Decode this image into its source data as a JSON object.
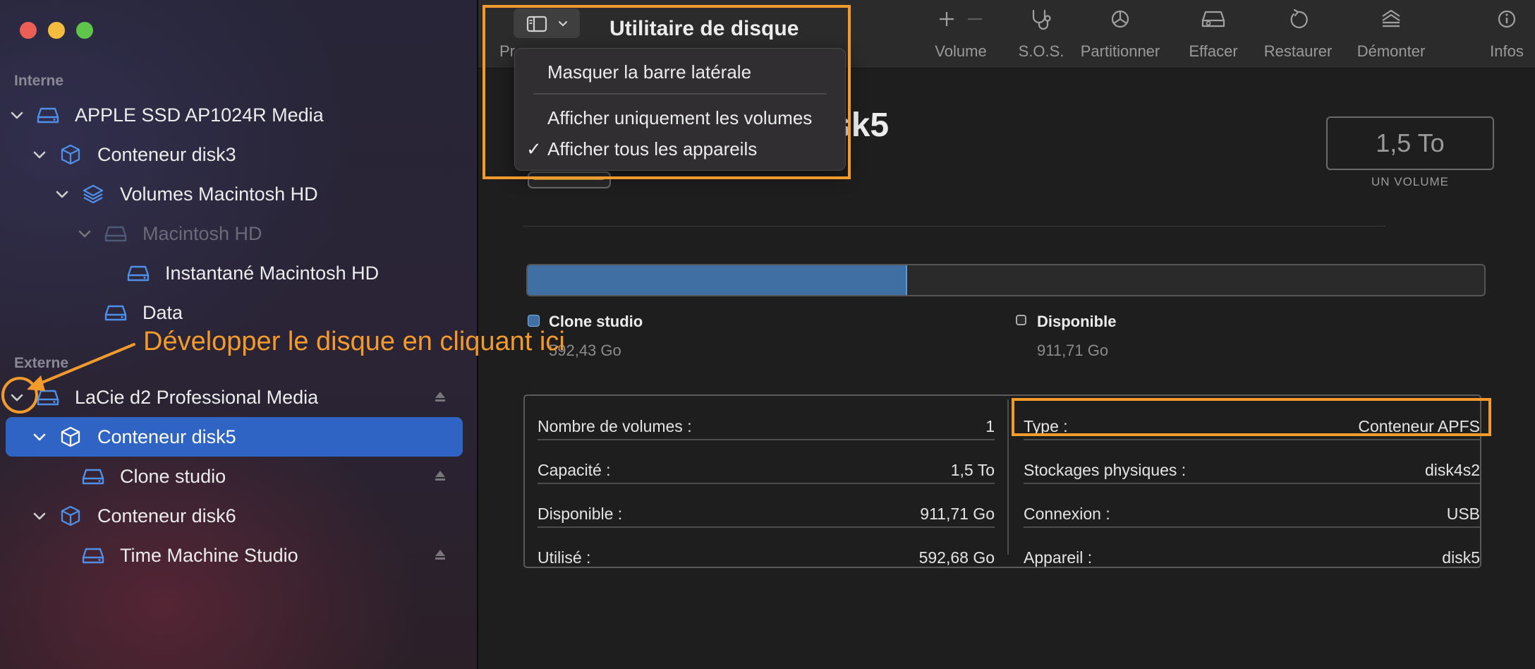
{
  "window": {
    "title": "Utilitaire de disque",
    "traffic_lights": {
      "close": "#ec5f57",
      "minimize": "#f4bd3d",
      "zoom": "#5ec44a"
    }
  },
  "sidebar": {
    "sections": [
      {
        "label": "Interne"
      },
      {
        "label": "Externe"
      }
    ],
    "items": [
      {
        "label": "APPLE SSD AP1024R Media",
        "icon": "drive-icon"
      },
      {
        "label": "Conteneur disk3",
        "icon": "container-icon"
      },
      {
        "label": "Volumes Macintosh HD",
        "icon": "layers-icon"
      },
      {
        "label": "Macintosh HD",
        "icon": "drive-icon"
      },
      {
        "label": "Instantané Macintosh HD",
        "icon": "drive-icon"
      },
      {
        "label": "Data",
        "icon": "drive-icon"
      },
      {
        "label": "LaCie d2 Professional Media",
        "icon": "drive-icon"
      },
      {
        "label": "Conteneur disk5",
        "icon": "container-icon"
      },
      {
        "label": "Clone studio",
        "icon": "drive-icon"
      },
      {
        "label": "Conteneur disk6",
        "icon": "container-icon"
      },
      {
        "label": "Time Machine Studio",
        "icon": "drive-icon"
      }
    ],
    "selected_color": "#2f64c4"
  },
  "toolbar": {
    "partial_label": "Pr",
    "buttons": [
      {
        "label": "Volume",
        "icon": "plus-minus-icon"
      },
      {
        "label": "S.O.S.",
        "icon": "stethoscope-icon"
      },
      {
        "label": "Partitionner",
        "icon": "pie-icon"
      },
      {
        "label": "Effacer",
        "icon": "eraser-drive-icon"
      },
      {
        "label": "Restaurer",
        "icon": "restore-icon"
      },
      {
        "label": "Démonter",
        "icon": "unmount-icon"
      },
      {
        "label": "Infos",
        "icon": "info-icon"
      }
    ]
  },
  "view_menu": {
    "items": [
      {
        "label": "Masquer la barre latérale",
        "checked": false
      },
      {
        "label": "Afficher uniquement les volumes",
        "checked": false
      },
      {
        "label": "Afficher tous les appareils",
        "checked": true
      }
    ],
    "check_glyph": "✓"
  },
  "detail": {
    "title_visible": "sk5",
    "capacity": "1,5 To",
    "capacity_caption": "UN VOLUME",
    "usage": {
      "used_fraction": 0.395,
      "legend": [
        {
          "name": "Clone studio",
          "value": "592,43 Go",
          "color": "#3f6fa3"
        },
        {
          "name": "Disponible",
          "value": "911,71 Go",
          "color": "#2a2a2a"
        }
      ]
    },
    "info_left": [
      {
        "key": "Nombre de volumes :",
        "value": "1"
      },
      {
        "key": "Capacité :",
        "value": "1,5 To"
      },
      {
        "key": "Disponible :",
        "value": "911,71 Go"
      },
      {
        "key": "Utilisé :",
        "value": "592,68 Go"
      }
    ],
    "info_right": [
      {
        "key": "Type :",
        "value": "Conteneur APFS"
      },
      {
        "key": "Stockages physiques :",
        "value": "disk4s2"
      },
      {
        "key": "Connexion :",
        "value": "USB"
      },
      {
        "key": "Appareil :",
        "value": "disk5"
      }
    ]
  },
  "annotation": {
    "text": "Développer le disque en cliquant ici",
    "color": "#f39a2c"
  }
}
